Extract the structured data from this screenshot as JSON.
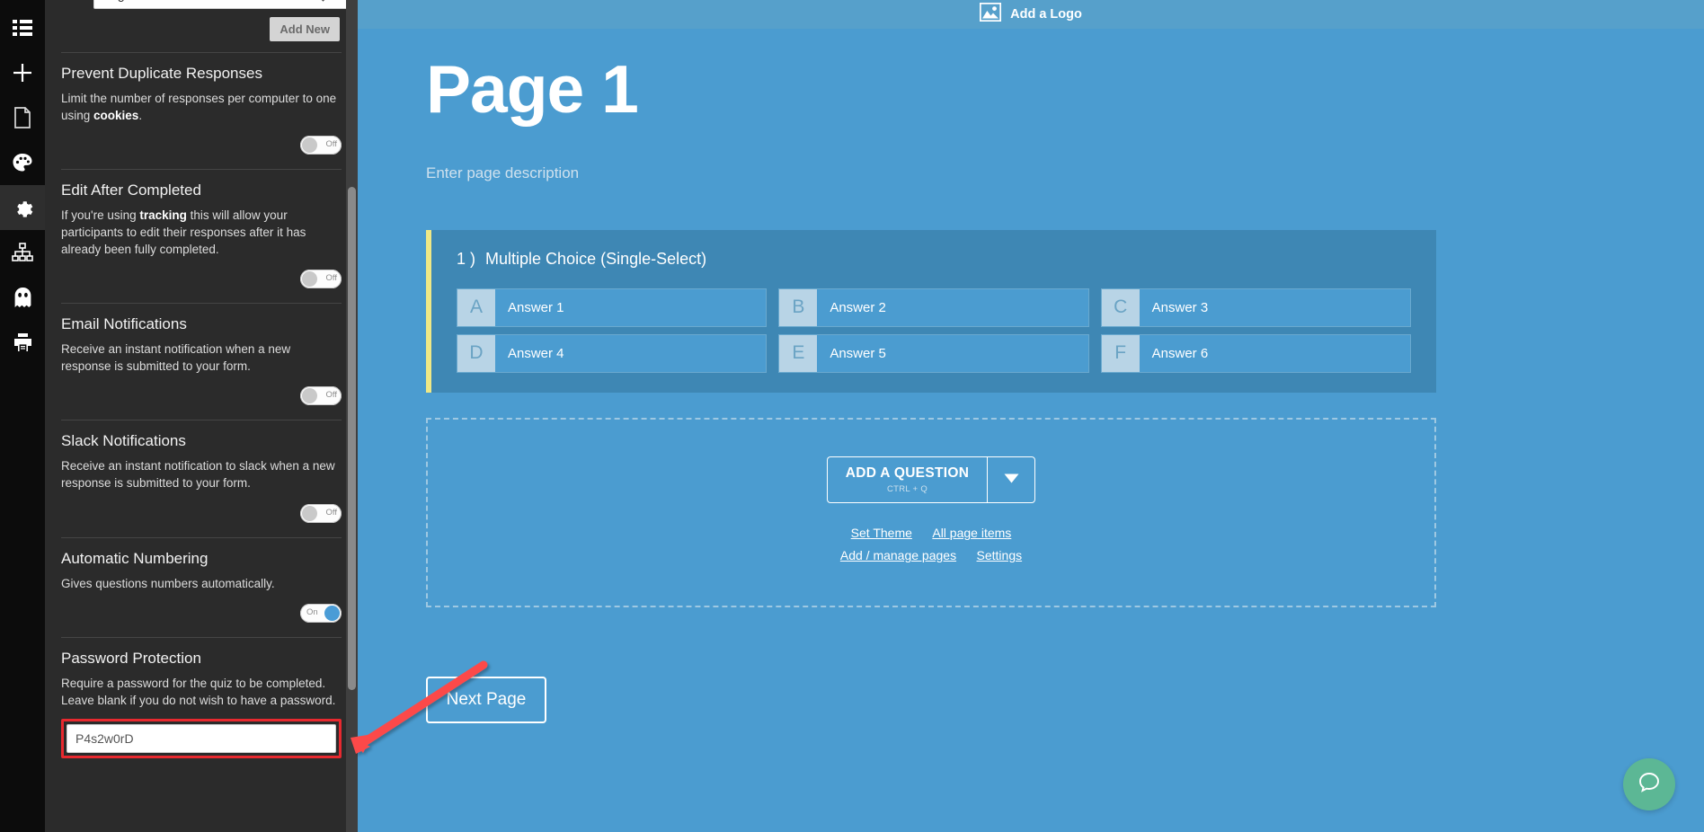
{
  "icon_rail": {
    "items": [
      {
        "name": "list-icon",
        "label": "Form items",
        "active": false
      },
      {
        "name": "plus-icon",
        "label": "Add",
        "active": false
      },
      {
        "name": "document-icon",
        "label": "Pages",
        "active": false
      },
      {
        "name": "palette-icon",
        "label": "Theme",
        "active": false
      },
      {
        "name": "gear-icon",
        "label": "Settings",
        "active": true
      },
      {
        "name": "sitemap-icon",
        "label": "Logic",
        "active": false
      },
      {
        "name": "ghost-icon",
        "label": "Preview",
        "active": false
      },
      {
        "name": "printer-icon",
        "label": "Print",
        "active": false
      }
    ]
  },
  "panel": {
    "language": {
      "selected": "English",
      "options": [
        "English"
      ]
    },
    "add_new_label": "Add New",
    "sections": [
      {
        "title": "Prevent Duplicate Responses",
        "desc_pre": "Limit the number of responses per computer to one using ",
        "desc_bold": "cookies",
        "desc_post": ".",
        "toggle_state": "Off",
        "toggle_on": false
      },
      {
        "title": "Edit After Completed",
        "desc_pre": "If you're using ",
        "desc_bold": "tracking",
        "desc_post": " this will allow your participants to edit their responses after it has already been fully completed.",
        "toggle_state": "Off",
        "toggle_on": false
      },
      {
        "title": "Email Notifications",
        "desc_pre": "Receive an instant notification when a new response is submitted to your form.",
        "desc_bold": "",
        "desc_post": "",
        "toggle_state": "Off",
        "toggle_on": false
      },
      {
        "title": "Slack Notifications",
        "desc_pre": "Receive an instant notification to slack when a new response is submitted to your form.",
        "desc_bold": "",
        "desc_post": "",
        "toggle_state": "Off",
        "toggle_on": false
      },
      {
        "title": "Automatic Numbering",
        "desc_pre": "Gives questions numbers automatically.",
        "desc_bold": "",
        "desc_post": "",
        "toggle_state": "On",
        "toggle_on": true
      }
    ],
    "password_section": {
      "title": "Password Protection",
      "desc": "Require a password for the quiz to be completed. Leave blank if you do not wish to have a password.",
      "value": "P4s2w0rD",
      "placeholder": "",
      "highlight_color": "#e8292f"
    }
  },
  "main": {
    "logo_bar": {
      "label": "Add a Logo",
      "icon": "image-icon"
    },
    "page_title": "Page 1",
    "page_description_placeholder": "Enter page description",
    "question": {
      "number": "1 )",
      "title": "Multiple Choice (Single-Select)",
      "accent_color": "#efe886",
      "answers": [
        {
          "letter": "A",
          "text": "Answer 1"
        },
        {
          "letter": "B",
          "text": "Answer 2"
        },
        {
          "letter": "C",
          "text": "Answer 3"
        },
        {
          "letter": "D",
          "text": "Answer 4"
        },
        {
          "letter": "E",
          "text": "Answer 5"
        },
        {
          "letter": "F",
          "text": "Answer 6"
        }
      ]
    },
    "add_question": {
      "label": "ADD A QUESTION",
      "shortcut": "CTRL + Q",
      "caret_icon": "chevron-down-icon"
    },
    "zone_links": [
      {
        "label": "Set Theme"
      },
      {
        "label": "All page items"
      },
      {
        "label": "Add / manage pages"
      },
      {
        "label": "Settings"
      }
    ],
    "next_page_label": "Next Page",
    "chat_bubble": {
      "icon": "chat-icon",
      "color": "#5cb795"
    }
  },
  "theme": {
    "canvas_blue": "#4b9cd0",
    "panel_dark": "#2b2b2b",
    "rail_black": "#0c0c0c",
    "toggle_on_color": "#4a9cd6"
  }
}
